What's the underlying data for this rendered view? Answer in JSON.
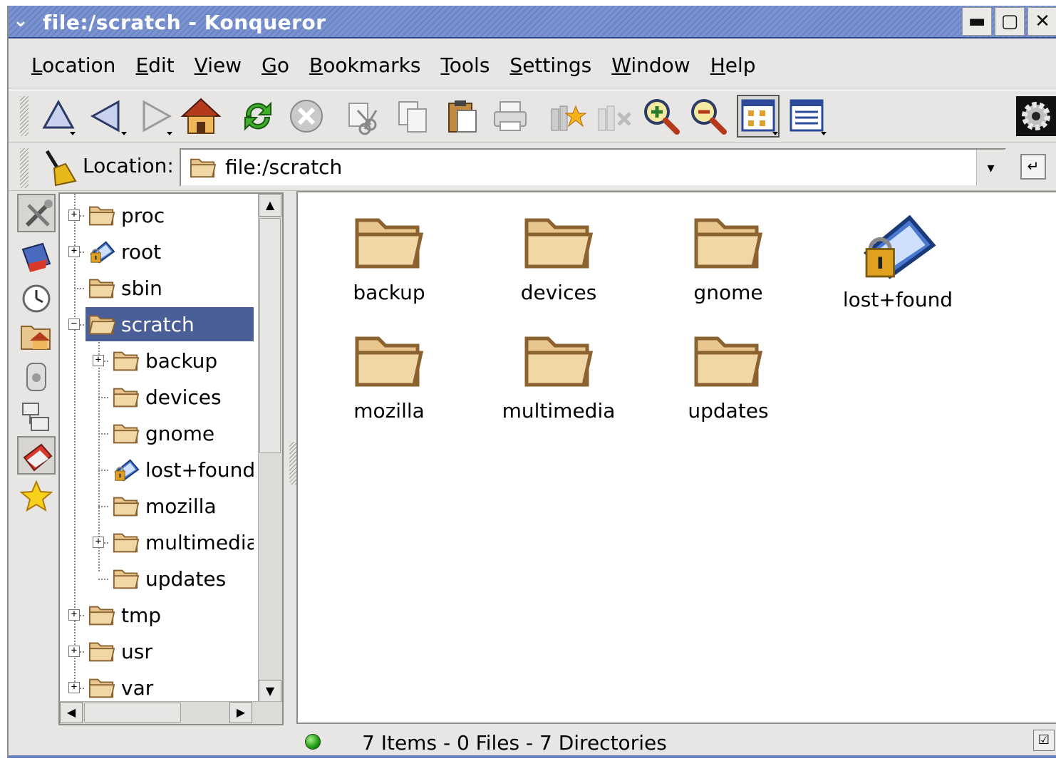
{
  "window": {
    "title": "file:/scratch - Konqueror"
  },
  "titlebar": {
    "minimize": "▬",
    "maximize": "▢",
    "close": "✕"
  },
  "menu": [
    "Location",
    "Edit",
    "View",
    "Go",
    "Bookmarks",
    "Tools",
    "Settings",
    "Window",
    "Help"
  ],
  "location": {
    "label": "Location:",
    "value": "file:/scratch"
  },
  "tree": [
    {
      "label": "proc",
      "level": 0,
      "expander": "+",
      "icon": "folder-icon"
    },
    {
      "label": "root",
      "level": 0,
      "expander": "+",
      "icon": "locked-folder-icon"
    },
    {
      "label": "sbin",
      "level": 0,
      "expander": "",
      "icon": "folder-icon"
    },
    {
      "label": "scratch",
      "level": 0,
      "expander": "−",
      "icon": "folder-open-icon",
      "selected": true
    },
    {
      "label": "backup",
      "level": 1,
      "expander": "+",
      "icon": "folder-icon"
    },
    {
      "label": "devices",
      "level": 1,
      "expander": "",
      "icon": "folder-icon"
    },
    {
      "label": "gnome",
      "level": 1,
      "expander": "",
      "icon": "folder-icon"
    },
    {
      "label": "lost+found",
      "level": 1,
      "expander": "",
      "icon": "locked-folder-icon"
    },
    {
      "label": "mozilla",
      "level": 1,
      "expander": "",
      "icon": "folder-icon"
    },
    {
      "label": "multimedia",
      "level": 1,
      "expander": "+",
      "icon": "folder-icon"
    },
    {
      "label": "updates",
      "level": 1,
      "expander": "",
      "icon": "folder-icon"
    },
    {
      "label": "tmp",
      "level": 0,
      "expander": "+",
      "icon": "folder-icon"
    },
    {
      "label": "usr",
      "level": 0,
      "expander": "+",
      "icon": "folder-icon"
    },
    {
      "label": "var",
      "level": 0,
      "expander": "+",
      "icon": "folder-icon"
    }
  ],
  "files": [
    {
      "name": "backup",
      "icon": "folder-icon"
    },
    {
      "name": "devices",
      "icon": "folder-icon"
    },
    {
      "name": "gnome",
      "icon": "folder-icon"
    },
    {
      "name": "lost+found",
      "icon": "locked-folder-icon"
    },
    {
      "name": "mozilla",
      "icon": "folder-icon"
    },
    {
      "name": "multimedia",
      "icon": "folder-icon"
    },
    {
      "name": "updates",
      "icon": "folder-icon"
    }
  ],
  "status": {
    "text": "7 Items - 0 Files - 7 Directories"
  },
  "colors": {
    "titlebar": "#6a83c2",
    "selection": "#4a5f98",
    "folder": "#e9c68d"
  }
}
